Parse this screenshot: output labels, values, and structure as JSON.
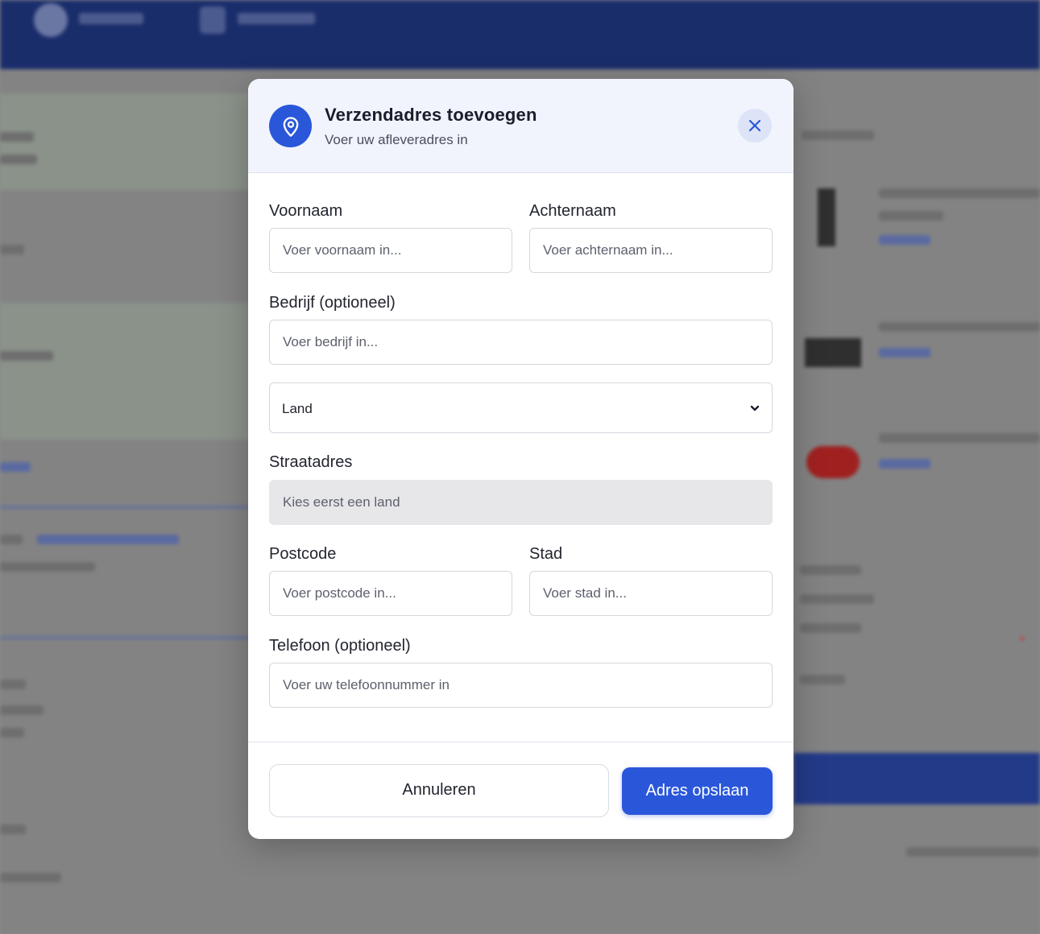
{
  "modal": {
    "title": "Verzendadres toevoegen",
    "subtitle": "Voer uw afleveradres in",
    "header_icon": "location-pin-icon",
    "close_icon": "close-icon",
    "accent_color": "#2a57d9"
  },
  "form": {
    "first_name": {
      "label": "Voornaam",
      "placeholder": "Voer voornaam in..."
    },
    "last_name": {
      "label": "Achternaam",
      "placeholder": "Voer achternaam in..."
    },
    "company": {
      "label": "Bedrijf (optioneel)",
      "placeholder": "Voer bedrijf in..."
    },
    "country": {
      "value": "Land"
    },
    "street": {
      "label": "Straatadres",
      "placeholder": "Kies eerst een land"
    },
    "postcode": {
      "label": "Postcode",
      "placeholder": "Voer postcode in..."
    },
    "city": {
      "label": "Stad",
      "placeholder": "Voer stad in..."
    },
    "phone": {
      "label": "Telefoon (optioneel)",
      "placeholder": "Voer uw telefoonnummer in"
    }
  },
  "actions": {
    "cancel_label": "Annuleren",
    "save_label": "Adres opslaan"
  }
}
